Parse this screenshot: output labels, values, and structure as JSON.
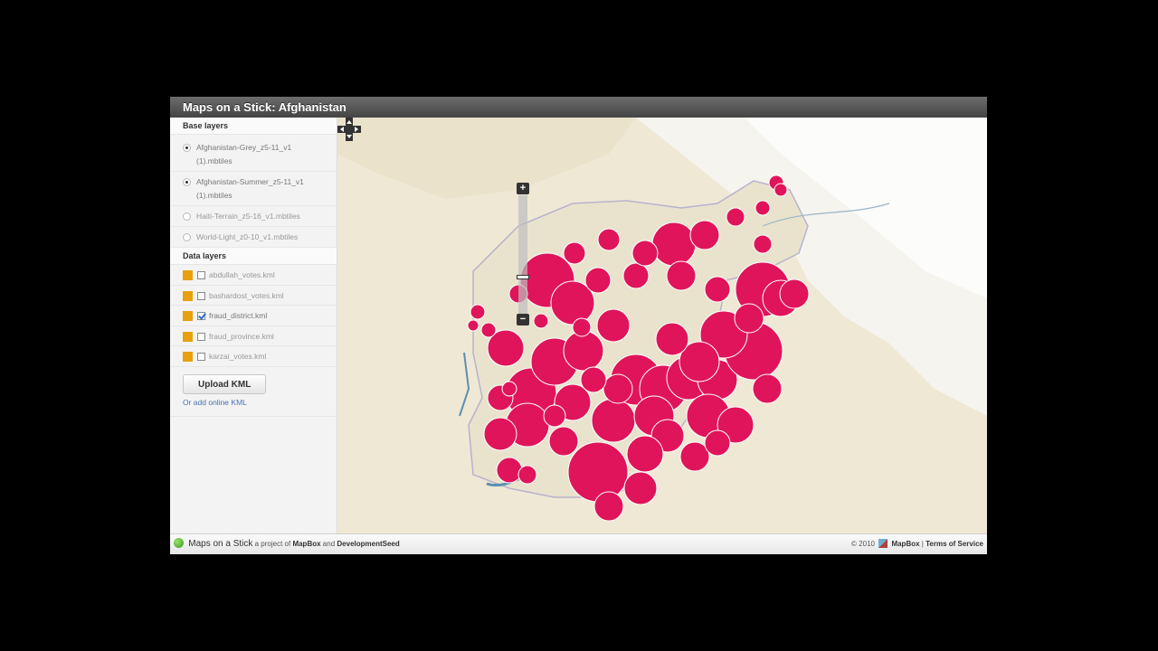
{
  "window": {
    "title": "Maps on a Stick: Afghanistan"
  },
  "sidebar": {
    "base_layers_header": "Base layers",
    "base_layers": [
      {
        "label": "Afghanistan-Grey_z5-11_v1 (1).mbtiles",
        "checked": true
      },
      {
        "label": "Afghanistan-Summer_z5-11_v1 (1).mbtiles",
        "checked": true
      },
      {
        "label": "Haiti-Terrain_z5-16_v1.mbtiles",
        "checked": false
      },
      {
        "label": "World-Light_z0-10_v1.mbtiles",
        "checked": false
      }
    ],
    "data_layers_header": "Data layers",
    "data_layers": [
      {
        "label": "abdullah_votes.kml",
        "checked": false,
        "color": "#e8a00c"
      },
      {
        "label": "bashardost_votes.kml",
        "checked": false,
        "color": "#e8a00c"
      },
      {
        "label": "fraud_district.kml",
        "checked": true,
        "color": "#e8a00c"
      },
      {
        "label": "fraud_province.kml",
        "checked": false,
        "color": "#e8a00c"
      },
      {
        "label": "karzai_votes.kml",
        "checked": false,
        "color": "#e8a00c"
      }
    ],
    "upload_button": "Upload KML",
    "add_link": "Or add online KML"
  },
  "map": {
    "zoom_in": "+",
    "zoom_out": "−",
    "zoom_level_fraction": 0.3,
    "marker_color": "#e0145a"
  },
  "footer": {
    "brand": "Maps on a Stick",
    "project_text": "a project of",
    "mapbox": "MapBox",
    "and": "and",
    "devseed": "DevelopmentSeed",
    "copyright": "© 2010",
    "mapbox_right": "MapBox",
    "separator": "|",
    "terms": "Terms of Service"
  }
}
